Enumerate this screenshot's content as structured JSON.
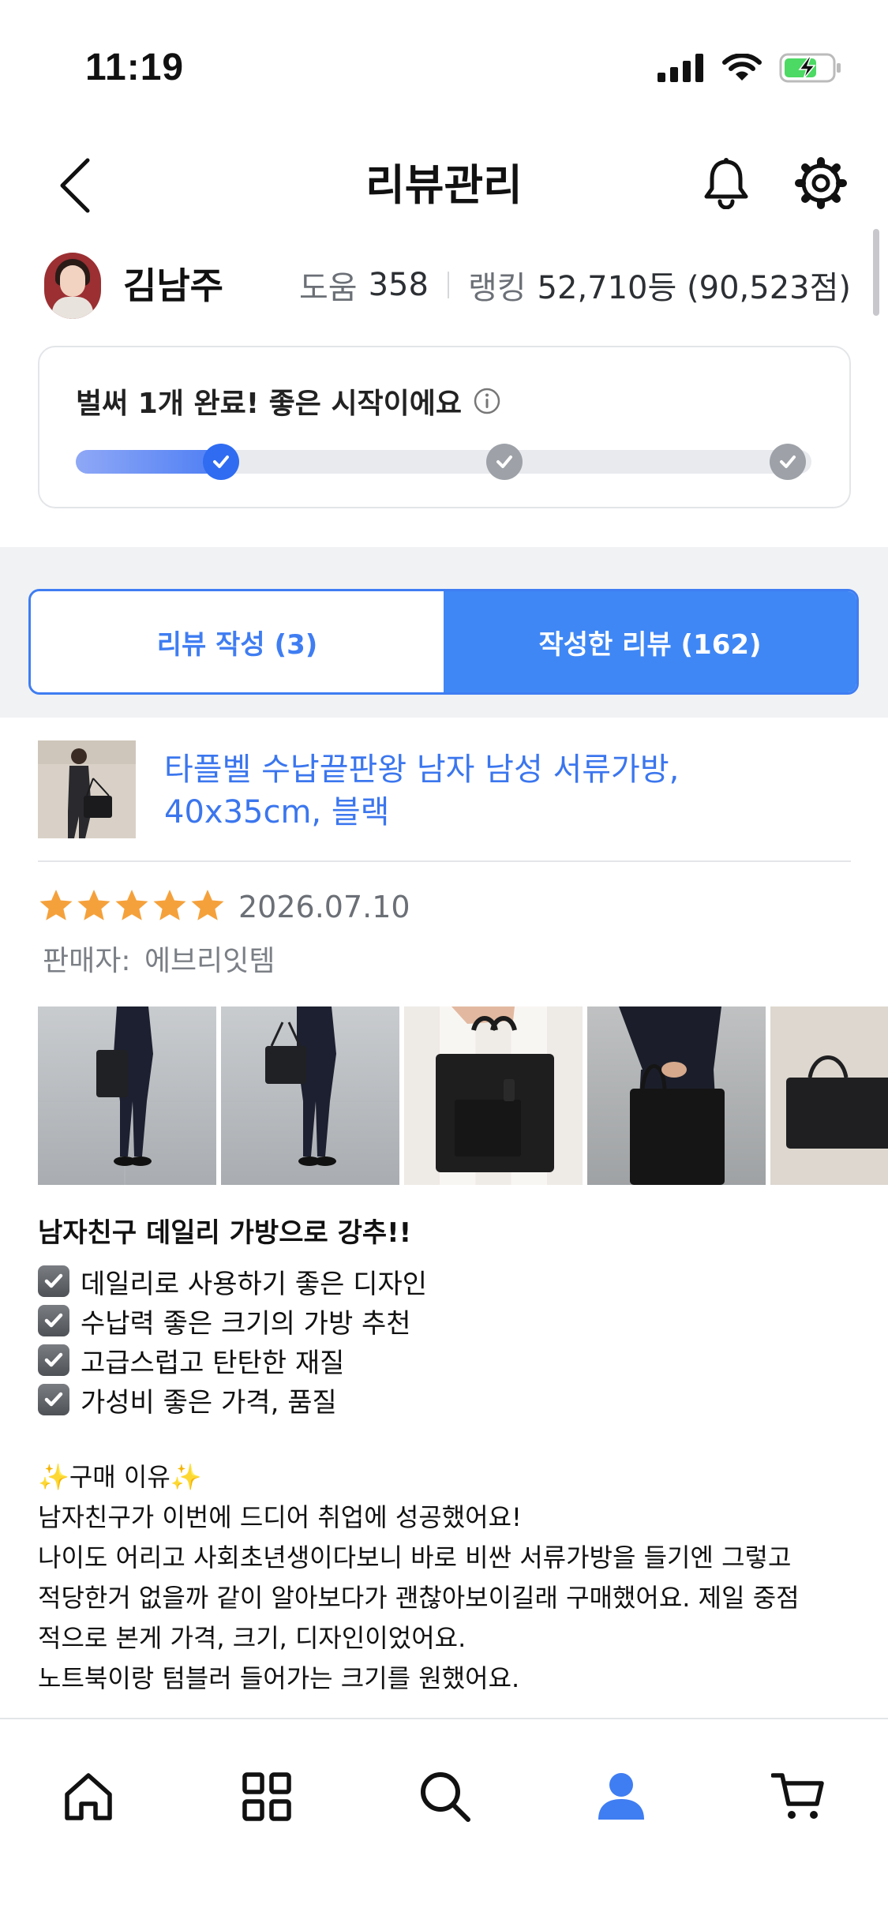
{
  "status_bar": {
    "time": "11:19"
  },
  "header": {
    "title": "리뷰관리"
  },
  "profile": {
    "name": "김남주",
    "help_label": "도움",
    "help_count": "358",
    "rank_label": "랭킹",
    "rank_value": "52,710등 (90,523점)"
  },
  "progress": {
    "message": "벌써 1개 완료! 좋은 시작이에요",
    "completed_steps": 1,
    "total_steps": 3
  },
  "tabs": [
    {
      "label": "리뷰 작성 (3)",
      "selected": false
    },
    {
      "label": "작성한 리뷰 (162)",
      "selected": true
    }
  ],
  "review": {
    "product_name": "타플벨 수납끝판왕 남자 남성 서류가방, 40x35cm, 블랙",
    "rating": 5,
    "date": "2026.07.10",
    "seller_label": "판매자:",
    "seller_name": "에브리잇템",
    "title": "남자친구 데일리 가방으로 강추!!",
    "checklist": [
      "데일리로 사용하기 좋은 디자인",
      "수납력 좋은 크기의 가방 추천",
      "고급스럽고 탄탄한 재질",
      "가성비 좋은 가격, 품질"
    ],
    "body_lines": [
      "✨구매 이유✨",
      "남자친구가 이번에 드디어 취업에 성공했어요!",
      "나이도 어리고 사회초년생이다보니 바로 비싼 서류가방을 들기엔 그렇고",
      "적당한거 없을까 같이 알아보다가 괜찮아보이길래 구매했어요. 제일 중점",
      "적으로 본게 가격, 크기, 디자인이었어요.",
      "노트북이랑 텀블러 들어가는 크기를 원했어요."
    ]
  },
  "colors": {
    "accent": "#3F87F5",
    "link": "#3B76EE",
    "star": "#F5A13B"
  },
  "bottom_nav": [
    {
      "icon": "home-icon",
      "active": false
    },
    {
      "icon": "category-grid-icon",
      "active": false
    },
    {
      "icon": "search-icon",
      "active": false
    },
    {
      "icon": "profile-icon",
      "active": true
    },
    {
      "icon": "cart-icon",
      "active": false
    }
  ]
}
